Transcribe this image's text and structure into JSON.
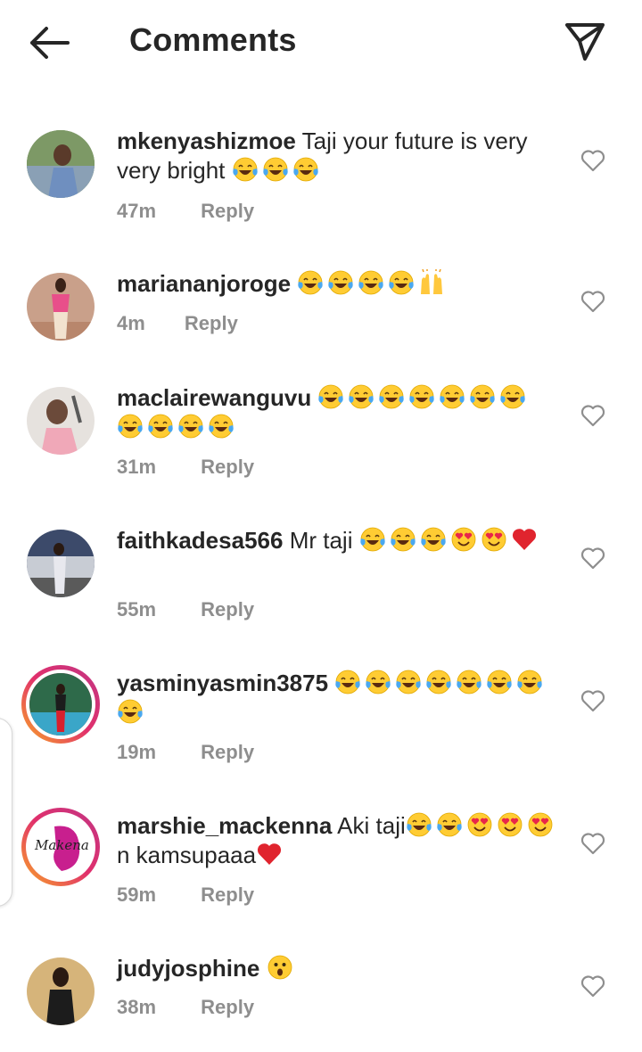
{
  "header": {
    "title": "Comments",
    "back_icon": "arrow-left-icon",
    "share_icon": "paper-plane-icon"
  },
  "comments": [
    {
      "username": "mkenyashizmoe",
      "text": "Taji your future is very very bright",
      "emojis": [
        "tears-of-joy",
        "tears-of-joy",
        "tears-of-joy"
      ],
      "time": "47m",
      "reply": "Reply",
      "story_ring": false
    },
    {
      "username": "mariananjoroge",
      "text": "",
      "emojis": [
        "tears-of-joy",
        "tears-of-joy",
        "tears-of-joy",
        "tears-of-joy",
        "raising-hands"
      ],
      "time": "4m",
      "reply": "Reply",
      "story_ring": false
    },
    {
      "username": "maclairewanguvu",
      "text": "",
      "emojis": [
        "tears-of-joy",
        "tears-of-joy",
        "tears-of-joy",
        "tears-of-joy",
        "tears-of-joy",
        "tears-of-joy",
        "tears-of-joy",
        "tears-of-joy",
        "tears-of-joy",
        "tears-of-joy",
        "tears-of-joy"
      ],
      "time": "31m",
      "reply": "Reply",
      "story_ring": false
    },
    {
      "username": "faithkadesa566",
      "text": "Mr taji",
      "emojis": [
        "tears-of-joy",
        "tears-of-joy",
        "tears-of-joy",
        "heart-eyes",
        "heart-eyes",
        "red-heart"
      ],
      "time": "55m",
      "reply": "Reply",
      "story_ring": false
    },
    {
      "username": "yasminyasmin3875",
      "text": "",
      "emojis": [
        "tears-of-joy",
        "tears-of-joy",
        "tears-of-joy",
        "tears-of-joy",
        "tears-of-joy",
        "tears-of-joy",
        "tears-of-joy",
        "tears-of-joy"
      ],
      "time": "19m",
      "reply": "Reply",
      "story_ring": true
    },
    {
      "username": "marshie_mackenna",
      "text": "Aki taji",
      "text_after": "n kamsupaaa",
      "emojis": [
        "tears-of-joy",
        "tears-of-joy",
        "heart-eyes",
        "heart-eyes",
        "heart-eyes"
      ],
      "trailing_emoji": "red-heart",
      "avatar_text": "Makena",
      "time": "59m",
      "reply": "Reply",
      "story_ring": true
    },
    {
      "username": "judyjosphine",
      "text": "",
      "emojis": [
        "astonished-face"
      ],
      "time": "38m",
      "reply": "Reply",
      "story_ring": false
    }
  ],
  "icons": {
    "like": "heart-outline-icon"
  },
  "colors": {
    "text": "#262626",
    "meta": "#8e8e8e",
    "story_ring_start": "#f9a825",
    "story_ring_end": "#c13584"
  }
}
